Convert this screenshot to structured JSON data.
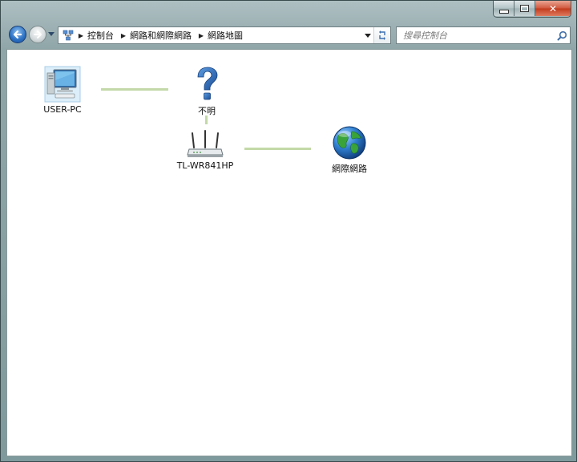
{
  "address_bar": {
    "crumbs": [
      "控制台",
      "網路和網際網路",
      "網路地圖"
    ]
  },
  "search": {
    "placeholder": "搜尋控制台"
  },
  "network_map": {
    "nodes": {
      "computer": "USER-PC",
      "unknown": "不明",
      "router": "TL-WR841HP",
      "internet": "網際網路"
    }
  },
  "colors": {
    "link": "#c3d9a8",
    "close_button": "#c9421f",
    "back_button": "#2a6fc2"
  },
  "icons": [
    "back-arrow-icon",
    "forward-arrow-icon",
    "network-folder-icon",
    "refresh-icon",
    "search-icon",
    "computer-icon",
    "question-mark-icon",
    "router-icon",
    "globe-icon"
  ]
}
